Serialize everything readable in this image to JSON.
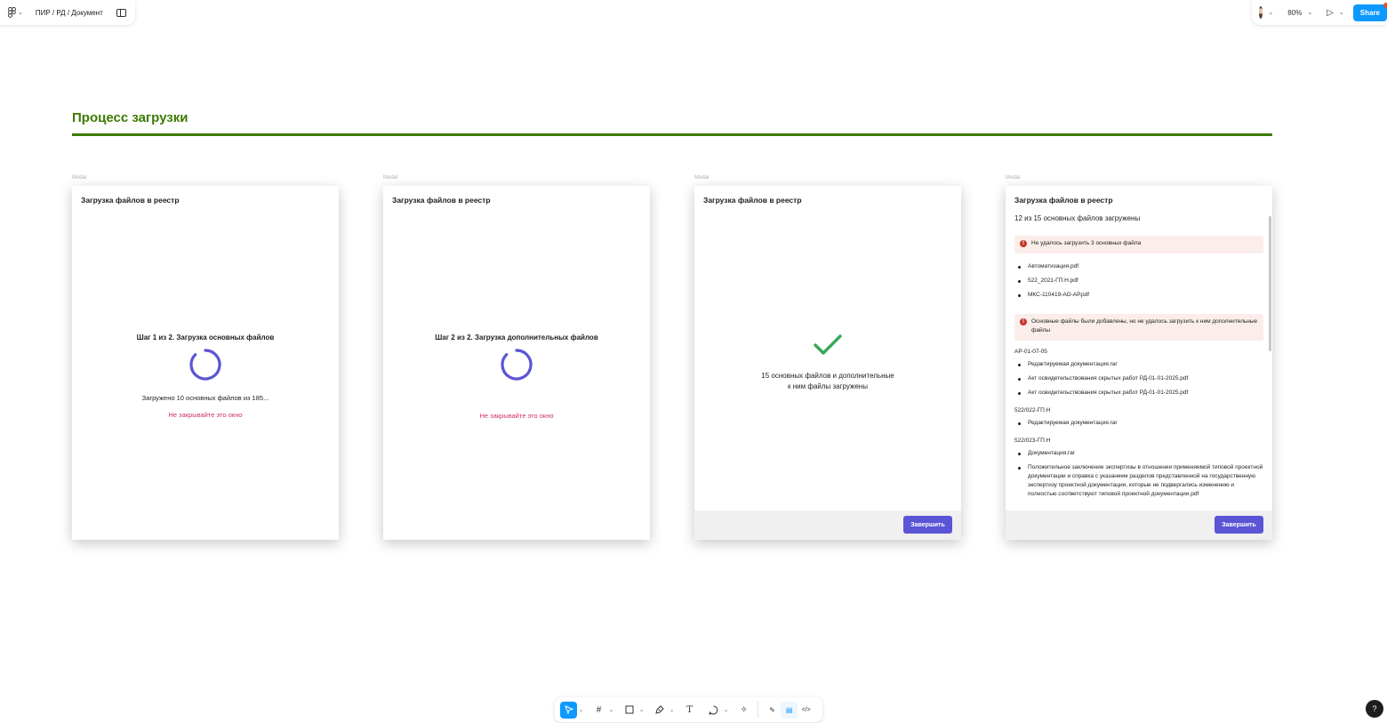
{
  "topbar_left": {
    "breadcrumb": "ПИР / РД / Документ",
    "logo_icon": "figma-icon",
    "panel_icon": "sidebar-toggle-icon"
  },
  "topbar_right": {
    "zoom": "80%",
    "share_label": "Share",
    "accent": "#0d99ff"
  },
  "page": {
    "title": "Процесс загрузки",
    "title_color": "#3d7a00"
  },
  "frame_label": "Modal",
  "modals": [
    {
      "title": "Загрузка файлов в реестр",
      "step": "Шаг 1 из 2. Загрузка основных файлов",
      "progress": "Загружено 10 основных файлов из 185...",
      "warning": "Не закрывайте это окно"
    },
    {
      "title": "Загрузка файлов в реестр",
      "step": "Шаг 2 из 2. Загрузка дополнительных файлов",
      "warning": "Не закрывайте это окно"
    },
    {
      "title": "Загрузка файлов в реестр",
      "success_line1": "15 основных файлов и дополнительные",
      "success_line2": "к ним файлы загружены",
      "finish_label": "Завершить"
    },
    {
      "title": "Загрузка файлов в реестр",
      "summary": "12 из 15 основных файлов загружены",
      "alert1": "Не удалось загрузить 3 основных файла",
      "failed_files": [
        "Автоматизация.pdf",
        "522_2021-ГП.Н.pdf",
        "МКС-110419-АО-АР.pdf"
      ],
      "alert2": "Основные файлы были добавлены, но не удалось загрузить к ним дополнительные файлы",
      "groups": [
        {
          "label": "АР-01-07-05",
          "files": [
            "Редактируемая документация.rar",
            "Акт освидетельствования скрытых работ РД-01-01-2025.pdf",
            "Акт освидетельствования скрытых работ РД-01-01-2025.pdf"
          ]
        },
        {
          "label": "522/022-ГП.Н",
          "files": [
            "Редактируемая документация.rar"
          ]
        },
        {
          "label": "522/023-ГП.Н",
          "files": [
            "Документация.rar",
            "Положительное заключение экспертизы в отношении применяемой типовой проектной документации и справка с указанием разделов представленной на государственную экспертизу проектной документации, которые не подвергались изменению и полностью соответствуют типовой проектной документации.pdf"
          ]
        }
      ],
      "finish_label": "Завершить"
    }
  ],
  "bottom_toolbar": {
    "tools": [
      "move-tool",
      "frame-tool",
      "rectangle-tool",
      "pen-tool",
      "text-tool",
      "comment-tool",
      "actions-tool"
    ],
    "modes": [
      "draw-mode",
      "design-mode",
      "dev-mode"
    ]
  },
  "help_label": "?"
}
